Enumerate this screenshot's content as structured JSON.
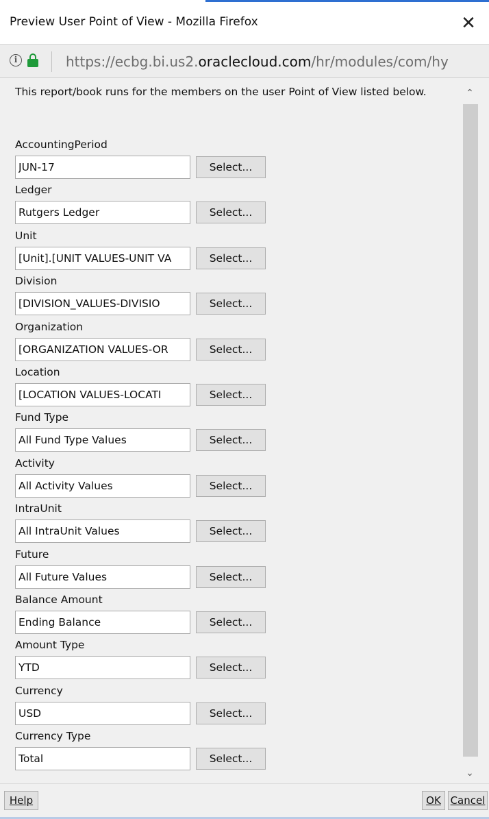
{
  "window": {
    "title": "Preview User Point of View - Mozilla Firefox",
    "close_glyph": "✕"
  },
  "urlbar": {
    "info_glyph": "i",
    "url_prefix": "https://ecbg.bi.us2.",
    "url_domain": "oraclecloud.com",
    "url_suffix": "/hr/modules/com/hy"
  },
  "intro": "This report/book runs for the members on the user Point of View listed below.",
  "select_label": "Select...",
  "fields": [
    {
      "label": "AccountingPeriod",
      "value": "JUN-17"
    },
    {
      "label": "Ledger",
      "value": "Rutgers Ledger"
    },
    {
      "label": "Unit",
      "value": "[Unit].[UNIT VALUES-UNIT VA"
    },
    {
      "label": "Division",
      "value": "[DIVISION_VALUES-DIVISIO"
    },
    {
      "label": "Organization",
      "value": "[ORGANIZATION VALUES-OR"
    },
    {
      "label": "Location",
      "value": "[LOCATION VALUES-LOCATI"
    },
    {
      "label": "Fund Type",
      "value": "All Fund Type Values"
    },
    {
      "label": "Activity",
      "value": "All Activity Values"
    },
    {
      "label": "IntraUnit",
      "value": "All IntraUnit Values"
    },
    {
      "label": "Future",
      "value": "All Future Values"
    },
    {
      "label": "Balance Amount",
      "value": "Ending Balance"
    },
    {
      "label": "Amount Type",
      "value": "YTD"
    },
    {
      "label": "Currency",
      "value": "USD"
    },
    {
      "label": "Currency Type",
      "value": "Total"
    }
  ],
  "scroll": {
    "up_glyph": "⌃",
    "down_glyph": "⌄"
  },
  "buttons": {
    "help": "Help",
    "ok": "OK",
    "cancel": "Cancel"
  },
  "colors": {
    "lock": "#1f9a3a",
    "dialog_bg": "#f0f0f0",
    "button_bg": "#e1e1e1"
  }
}
